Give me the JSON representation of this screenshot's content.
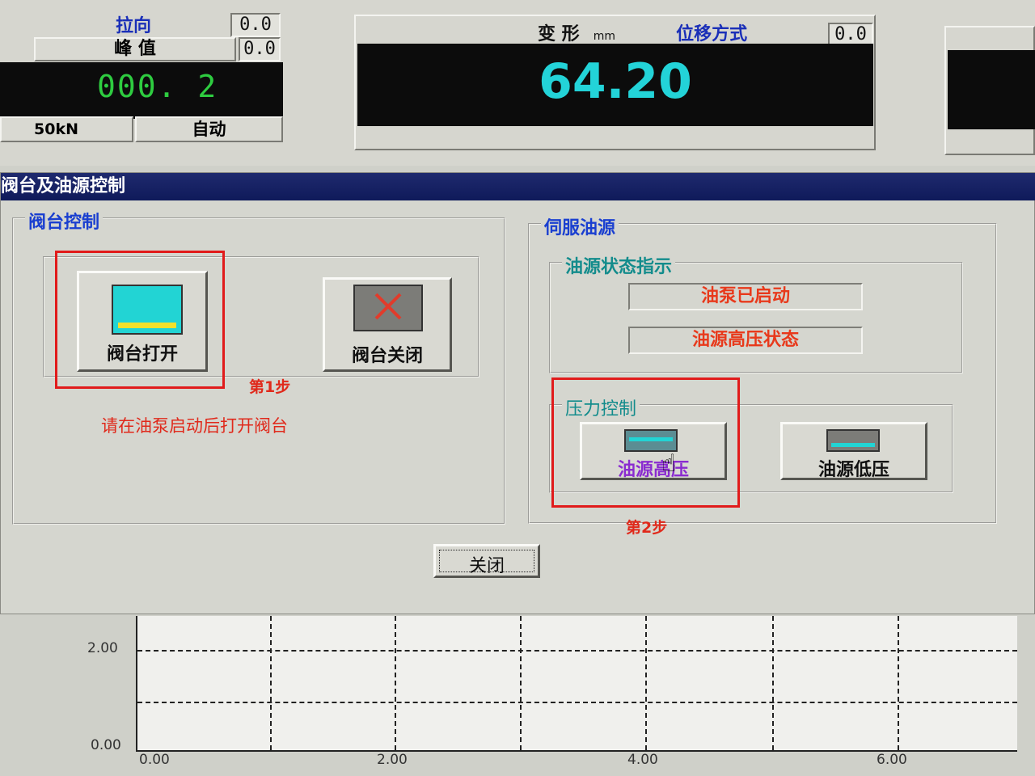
{
  "status_panel": {
    "direction_label": "拉向",
    "direction_value": "0.0",
    "peak_label": "峰   值",
    "peak_value": "0.0",
    "force_display": "000. 2",
    "range_label": "50kN",
    "mode_label": "自动"
  },
  "deform_panel": {
    "label": "变 形",
    "unit": "mm",
    "mode_label": "位移方式",
    "mode_value": "0.0",
    "display": "64.20"
  },
  "dialog": {
    "title": "阀台及油源控制",
    "valve_group": {
      "title": "阀台控制",
      "open_button": "阀台打开",
      "close_button": "阀台关闭",
      "hint": "请在油泵启动后打开阀台"
    },
    "servo_group": {
      "title": "伺服油源",
      "status_group_title": "油源状态指示",
      "status_items": [
        "油泵已启动",
        "油源高压状态"
      ],
      "pressure_group_title": "压力控制",
      "high_button": "油源高压",
      "low_button": "油源低压"
    },
    "close_button": "关闭"
  },
  "annotations": {
    "step1": "第1步",
    "step2": "第2步"
  },
  "chart_data": {
    "type": "line",
    "x_ticks": [
      "0.00",
      "2.00",
      "4.00",
      "6.00"
    ],
    "y_ticks": [
      "0.00",
      "2.00"
    ],
    "grid": true,
    "series": []
  },
  "colors": {
    "lcd_green": "#2ecc40",
    "lcd_cyan": "#23d3d8",
    "title_bar": "#16206a",
    "status_red": "#e8391b",
    "annotation_red": "#e11b1b"
  }
}
